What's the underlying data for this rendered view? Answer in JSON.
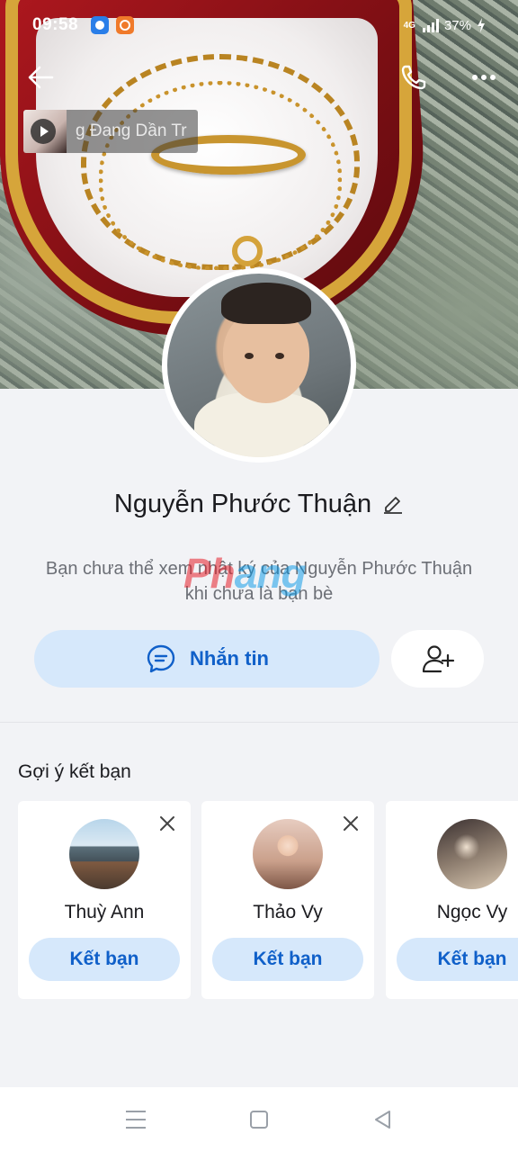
{
  "status_bar": {
    "time": "09:58",
    "network": "4G",
    "battery": "37%"
  },
  "music": {
    "title": "g Đang Dần Tr"
  },
  "profile": {
    "name": "Nguyễn Phước Thuận",
    "note": "Bạn chưa thể xem nhật ký của Nguyễn Phước Thuận khi chưa là bạn bè",
    "message_label": "Nhắn tin"
  },
  "watermark": {
    "lead": "Ph",
    "tail": "ang"
  },
  "suggestions": {
    "title": "Gợi ý kết bạn",
    "items": [
      {
        "name": "Thuỳ Ann",
        "button": "Kết bạn"
      },
      {
        "name": "Thảo Vy",
        "button": "Kết bạn"
      },
      {
        "name": "Ngọc Vy",
        "button": "Kết bạn"
      }
    ]
  },
  "colors": {
    "accent": "#1060c9",
    "button_bg": "#d6e8fb",
    "page_bg": "#f2f3f6"
  },
  "icons": [
    "back-arrow-icon",
    "phone-icon",
    "more-dots-icon",
    "play-icon",
    "edit-pencil-icon",
    "chat-bubble-icon",
    "add-user-icon",
    "close-icon",
    "menu-icon",
    "home-icon",
    "back-triangle-icon"
  ]
}
